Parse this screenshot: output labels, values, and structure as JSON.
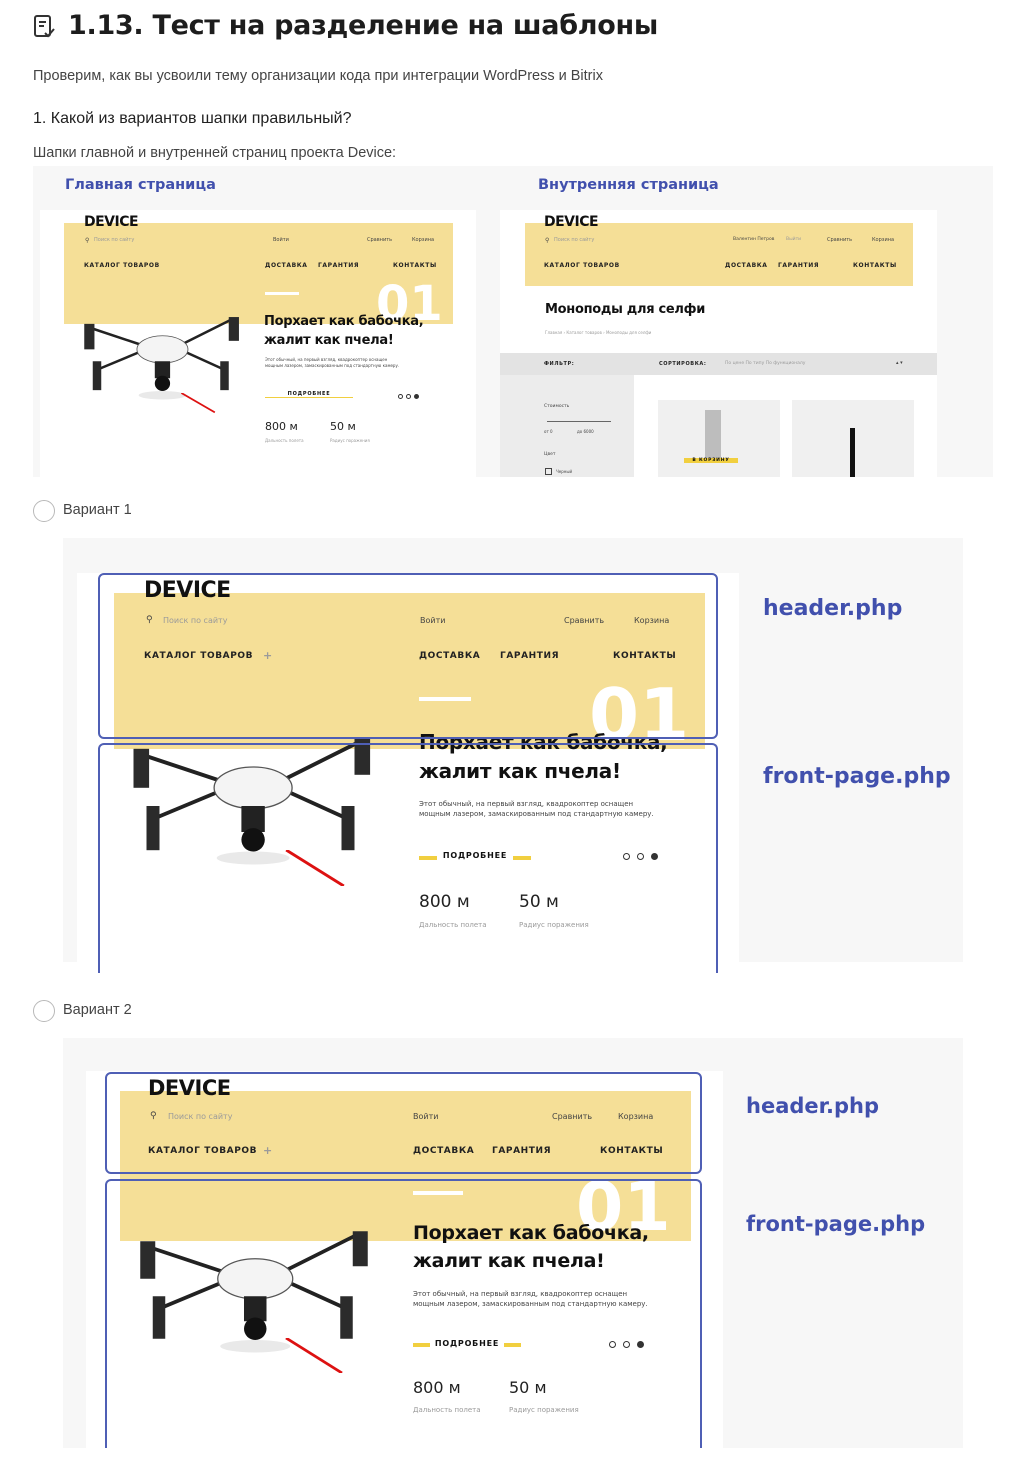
{
  "lesson": {
    "title": "1.13. Тест на разделение на шаблоны",
    "icon": "test-icon",
    "intro": "Проверим, как вы усвоили тему организации кода при интеграции WordPress и Bitrix"
  },
  "question": {
    "text": "1. Какой из вариантов шапки правильный?",
    "caption": "Шапки главной и внутренней страниц проекта Device:"
  },
  "main_panel": {
    "home_label": "Главная страница",
    "inner_label": "Внутренняя страница"
  },
  "site": {
    "logo": "DEVICE",
    "search": "Поиск по сайту",
    "login": "Войти",
    "compare": "Сравнить",
    "cart": "Корзина",
    "catalog": "КАТАЛОГ ТОВАРОВ",
    "plus": "+",
    "delivery": "ДОСТАВКА",
    "warranty": "ГАРАНТИЯ",
    "contacts": "КОНТАКТЫ",
    "slide_num": "01",
    "hero_line1": "Порхает как бабочка,",
    "hero_line2": "жалит как пчела!",
    "desc1": "Этот обычный, на первый взгляд, квадрокоптер оснащен",
    "desc2": "мощным лазером, замаскированным под стандартную камеру.",
    "more": "ПОДРОБНЕЕ",
    "stat1_val": "800 м",
    "stat1_label": "Дальность полета",
    "stat2_val": "50 м",
    "stat2_label": "Радиус поражения"
  },
  "inner": {
    "user": "Валентин Петров",
    "logout": "Выйти",
    "page_title": "Моноподы для селфи",
    "breadcrumb": "Главная  ›  Каталог товаров  ›  Моноподы для селфи",
    "filter": "ФИЛЬТР:",
    "sort": "СОРТИРОВКА:",
    "sort_opts": "По цене   По типу   По функционалу",
    "price": "Стоимость",
    "from": "от 0",
    "to": "до 6000",
    "color": "Цвет",
    "black": "Черный",
    "to_cart": "В КОРЗИНУ"
  },
  "options": [
    {
      "label": "Вариант 1",
      "header_tpl": "header.php",
      "front_tpl": "front-page.php"
    },
    {
      "label": "Вариант 2",
      "header_tpl": "header.php",
      "front_tpl": "front-page.php"
    }
  ],
  "colors": {
    "accent": "#4150ad",
    "yellow": "#f5df97",
    "line": "#4f5fb5"
  }
}
